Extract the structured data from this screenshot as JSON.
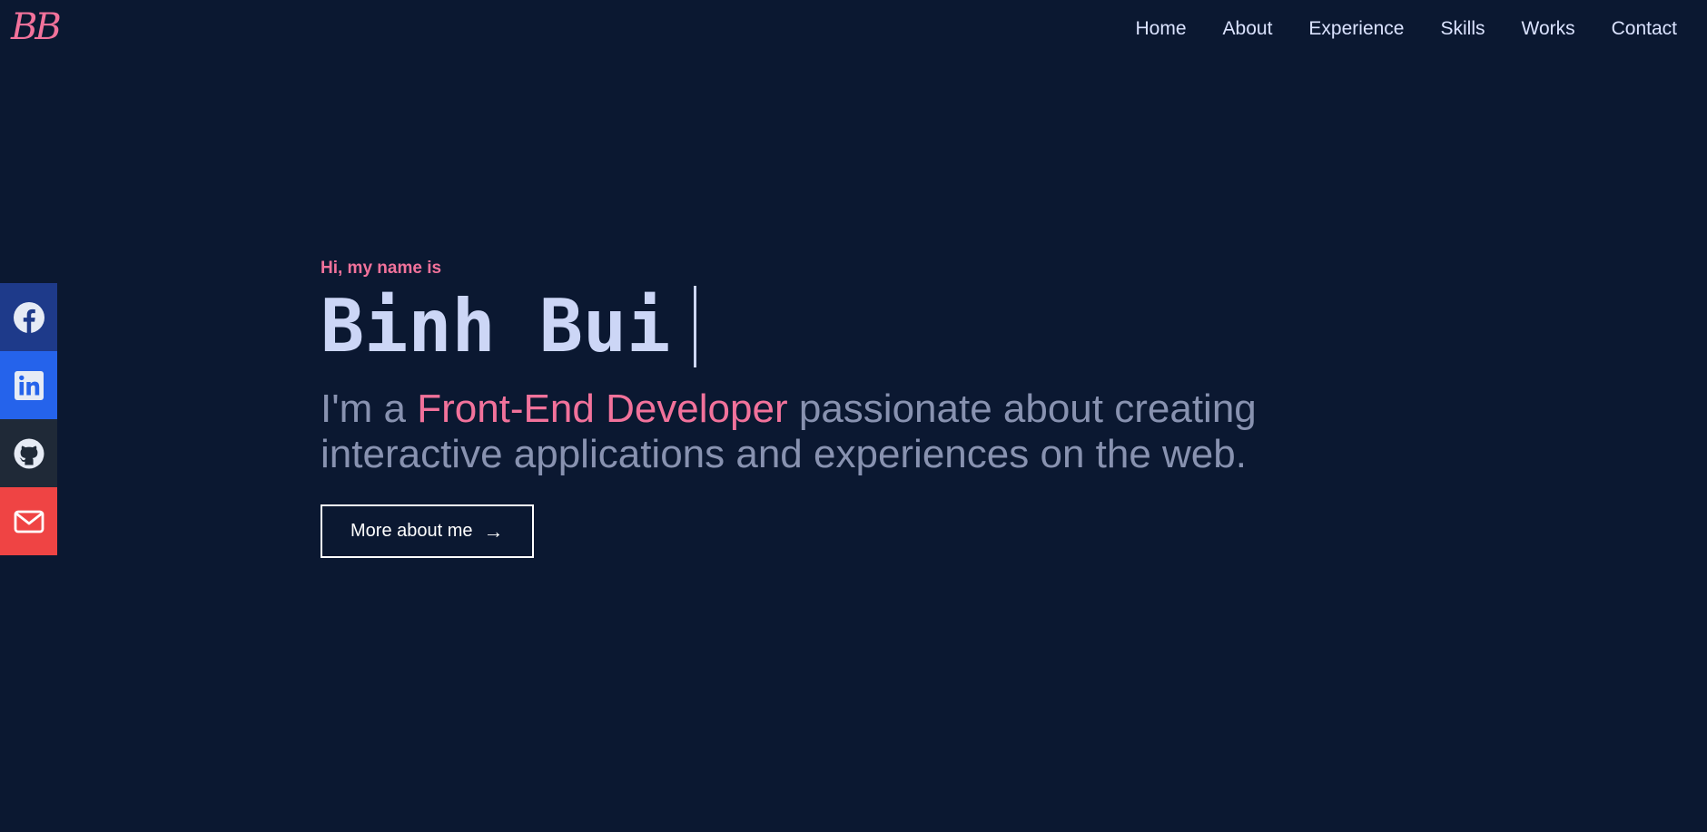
{
  "header": {
    "logo": "BB",
    "nav": [
      "Home",
      "About",
      "Experience",
      "Skills",
      "Works",
      "Contact"
    ]
  },
  "social": [
    {
      "icon": "facebook-icon",
      "color": "#1e3a8a"
    },
    {
      "icon": "linkedin-icon",
      "color": "#2563eb"
    },
    {
      "icon": "github-icon",
      "color": "#1f2937"
    },
    {
      "icon": "mail-icon",
      "color": "#ef4444"
    }
  ],
  "hero": {
    "greeting": "Hi, my name is",
    "name": "Binh Bui",
    "tagline_prefix": "I'm a ",
    "tagline_accent": "Front-End Developer",
    "tagline_suffix": " passionate about creating interactive applications and experiences on the web.",
    "cta_label": "More about me",
    "cta_arrow": "→"
  },
  "colors": {
    "background": "#0b1831",
    "accent": "#f2729b",
    "heading": "#ccd6f6",
    "body_text": "#8892b0"
  }
}
